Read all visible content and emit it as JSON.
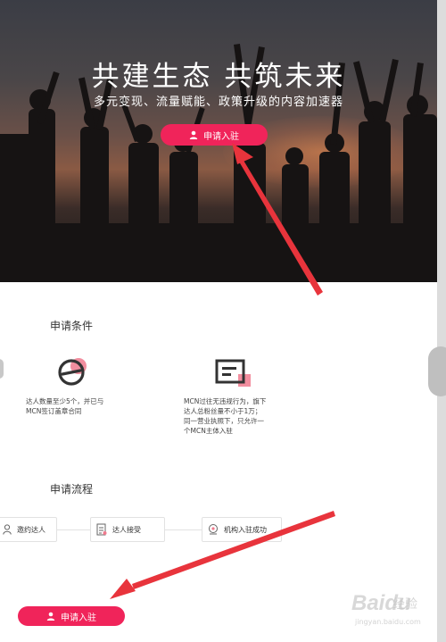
{
  "hero": {
    "title": "共建生态 共筑未来",
    "subtitle": "多元变现、流量赋能、政策升级的内容加速器",
    "apply_label": "申请入驻"
  },
  "conditions": {
    "title": "申请条件",
    "items": [
      {
        "icon": "target-ring-icon",
        "lines": [
          "达人数量至少5个，并已与",
          "MCN签订盖章合同"
        ]
      },
      {
        "icon": "document-icon",
        "lines": [
          "MCN过往无违规行为，旗下",
          "达人总粉丝量不小于1万；",
          "同一营业执照下，只允许一",
          "个MCN主体入驻"
        ]
      }
    ]
  },
  "process": {
    "title": "申请流程",
    "steps": [
      {
        "icon": "user-icon",
        "label": "邀约达人"
      },
      {
        "icon": "document-icon",
        "label": "达人接受"
      },
      {
        "icon": "location-pin-icon",
        "label": "机构入驻成功"
      }
    ]
  },
  "bottom": {
    "apply_label": "申请入驻"
  },
  "watermark": {
    "brand": "Baidu",
    "brand_cn": "经验",
    "url": "jingyan.baidu.com"
  },
  "colors": {
    "accent": "#f0245a",
    "annotation_arrow": "#e8343c",
    "icon_dark": "#333333",
    "icon_highlight": "#f07a8e"
  }
}
